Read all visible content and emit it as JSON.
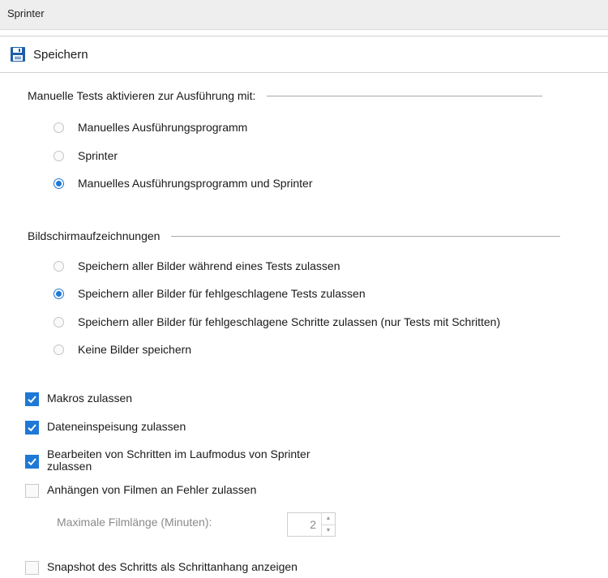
{
  "window": {
    "title": "Sprinter"
  },
  "toolbar": {
    "save_label": "Speichern",
    "save_icon": "floppy-disk-icon"
  },
  "manual_tests": {
    "title": "Manuelle Tests aktivieren zur Ausführung mit:",
    "options": [
      {
        "label": "Manuelles Ausführungsprogramm",
        "selected": false
      },
      {
        "label": "Sprinter",
        "selected": false
      },
      {
        "label": "Manuelles Ausführungsprogramm und Sprinter",
        "selected": true
      }
    ]
  },
  "screen_recording": {
    "title": "Bildschirmaufzeichnungen",
    "options": [
      {
        "label": "Speichern aller Bilder während eines Tests zulassen",
        "selected": false
      },
      {
        "label": "Speichern aller Bilder für fehlgeschlagene Tests zulassen",
        "selected": true
      },
      {
        "label": "Speichern aller Bilder für fehlgeschlagene Schritte zulassen (nur Tests mit Schritten)",
        "selected": false
      },
      {
        "label": "Keine Bilder speichern",
        "selected": false
      }
    ]
  },
  "checkboxes": [
    {
      "label": "Makros zulassen",
      "checked": true
    },
    {
      "label": "Dateneinspeisung zulassen",
      "checked": true
    },
    {
      "label": "Bearbeiten von Schritten im Laufmodus von Sprinter\nzulassen",
      "checked": true
    },
    {
      "label": "Anhängen von Filmen an Fehler zulassen",
      "checked": false
    }
  ],
  "film_length": {
    "label": "Maximale Filmlänge (Minuten):",
    "value": "2",
    "enabled": false
  },
  "snapshot": {
    "label": "Snapshot des Schritts als Schrittanhang anzeigen",
    "checked": false
  },
  "colors": {
    "accent": "#1e78d6",
    "titlebar_bg": "#eeeeee",
    "disabled_text": "#8a8a8a"
  }
}
